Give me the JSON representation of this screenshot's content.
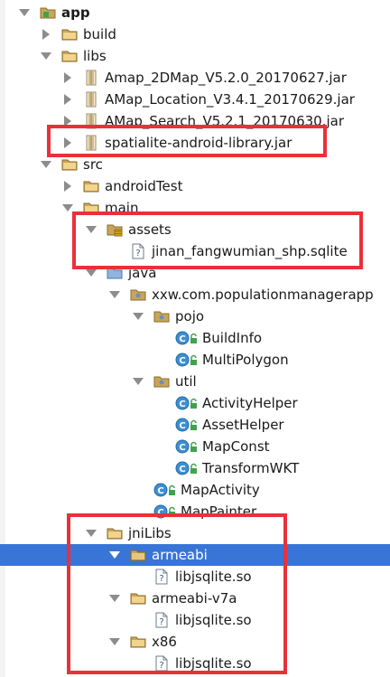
{
  "tree": {
    "items": [
      {
        "label": "app",
        "icon": "module-folder-icon",
        "bold": true,
        "expanded": true
      },
      {
        "label": "build",
        "icon": "folder-icon",
        "expanded": false
      },
      {
        "label": "libs",
        "icon": "folder-icon",
        "expanded": true
      },
      {
        "label": "Amap_2DMap_V5.2.0_20170627.jar",
        "icon": "jar-icon",
        "expanded": false
      },
      {
        "label": "AMap_Location_V3.4.1_20170629.jar",
        "icon": "jar-icon",
        "expanded": false
      },
      {
        "label": "AMap_Search_V5.2.1_20170630.jar",
        "icon": "jar-icon",
        "expanded": false
      },
      {
        "label": "spatialite-android-library.jar",
        "icon": "jar-icon",
        "expanded": false
      },
      {
        "label": "src",
        "icon": "folder-icon",
        "expanded": true
      },
      {
        "label": "androidTest",
        "icon": "folder-icon",
        "expanded": false
      },
      {
        "label": "main",
        "icon": "folder-icon",
        "expanded": true
      },
      {
        "label": "assets",
        "icon": "assets-folder-icon",
        "expanded": true
      },
      {
        "label": "jinan_fangwumian_shp.sqlite",
        "icon": "unknown-file-icon"
      },
      {
        "label": "java",
        "icon": "source-folder-icon",
        "expanded": true
      },
      {
        "label": "xxw.com.populationmanagerapp",
        "icon": "package-icon",
        "expanded": true
      },
      {
        "label": "pojo",
        "icon": "package-icon",
        "expanded": true
      },
      {
        "label": "BuildInfo",
        "icon": "class-icon"
      },
      {
        "label": "MultiPolygon",
        "icon": "class-icon"
      },
      {
        "label": "util",
        "icon": "package-icon",
        "expanded": true
      },
      {
        "label": "ActivityHelper",
        "icon": "class-icon"
      },
      {
        "label": "AssetHelper",
        "icon": "class-icon"
      },
      {
        "label": "MapConst",
        "icon": "class-icon"
      },
      {
        "label": "TransformWKT",
        "icon": "class-icon"
      },
      {
        "label": "MapActivity",
        "icon": "class-icon"
      },
      {
        "label": "MapPainter",
        "icon": "class-icon"
      },
      {
        "label": "jniLibs",
        "icon": "folder-icon",
        "expanded": true
      },
      {
        "label": "armeabi",
        "icon": "folder-icon",
        "expanded": true,
        "selected": true
      },
      {
        "label": "libjsqlite.so",
        "icon": "unknown-file-icon"
      },
      {
        "label": "armeabi-v7a",
        "icon": "folder-icon",
        "expanded": true
      },
      {
        "label": "libjsqlite.so",
        "icon": "unknown-file-icon"
      },
      {
        "label": "x86",
        "icon": "folder-icon",
        "expanded": true
      },
      {
        "label": "libjsqlite.so",
        "icon": "unknown-file-icon"
      }
    ]
  },
  "colors": {
    "selection": "#3875d7",
    "highlight_border": "#e8313a",
    "folder": "#c9a55a",
    "class_badge": "#3d8fd1",
    "lock_green": "#3fa34d"
  }
}
